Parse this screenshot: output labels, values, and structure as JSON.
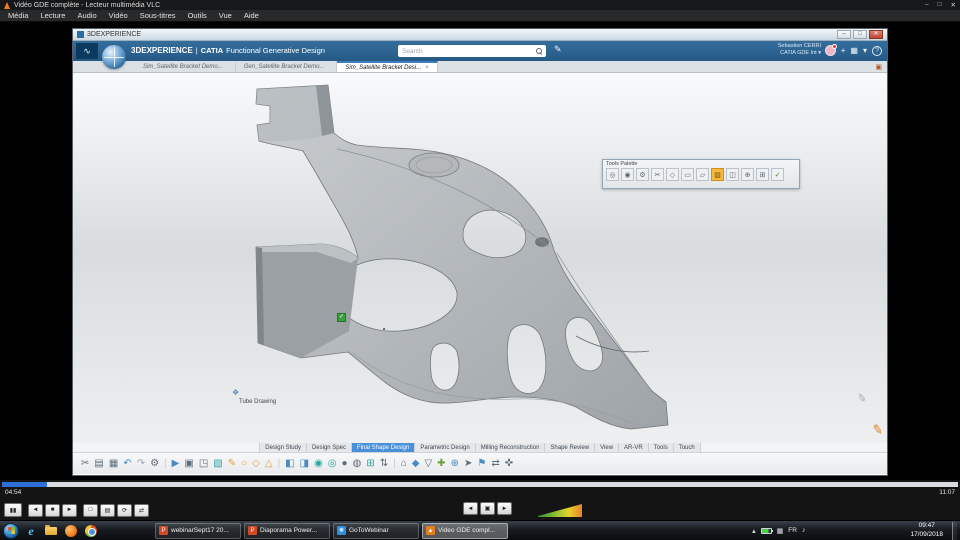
{
  "vlc": {
    "title": "Vidéo GDE complète - Lecteur multimédia VLC",
    "menu": [
      "Média",
      "Lecture",
      "Audio",
      "Vidéo",
      "Sous-titres",
      "Outils",
      "Vue",
      "Aide"
    ],
    "transport": {
      "time_current": "04:54",
      "time_total": "11:07",
      "progress_percent": 4.7,
      "primary": [
        {
          "g": "▮▮",
          "name": "pause"
        }
      ],
      "secondary": [
        {
          "g": "◄",
          "name": "previous"
        },
        {
          "g": "■",
          "name": "stop"
        },
        {
          "g": "►",
          "name": "next"
        }
      ],
      "tertiary": [
        {
          "g": "□",
          "name": "fullscreen"
        },
        {
          "g": "▤",
          "name": "playlist"
        },
        {
          "g": "⟳",
          "name": "loop"
        },
        {
          "g": "⇄",
          "name": "shuffle"
        }
      ],
      "center": [
        {
          "g": "◄",
          "name": "step-back"
        },
        {
          "g": "▣",
          "name": "bookmark"
        },
        {
          "g": "►",
          "name": "step-forward"
        }
      ]
    }
  },
  "icons": {
    "minimize": "–",
    "maximize": "□",
    "close": "✕",
    "ds_logo": "∿",
    "share": "✎",
    "plus": "+",
    "apps_grid": "▦",
    "caret_down": "▾",
    "help": "?",
    "tab_expand": "▣",
    "annotation": "❖",
    "green_check": "✓",
    "cursor_pencil": "✐",
    "tray_hidden": "▴",
    "tray_grid": "▦",
    "tray_volume": "♪",
    "ie": "e"
  },
  "app": {
    "window_title": "3DEXPERIENCE",
    "header": {
      "brand": "3DEXPERIENCE",
      "divider": "|",
      "product": "CATIA",
      "app_name": "Functional Generative Design",
      "search_placeholder": "Search",
      "user_name": "Sebastien CERRI",
      "user_role": "CATIA GDE Int ▾"
    },
    "tabs": [
      {
        "label": "Sim_Satellite Bracket Demo..."
      },
      {
        "label": "Gen_Satellite Bracket Demo..."
      },
      {
        "label": "Sim_Satellite Bracket Desi...",
        "active": true,
        "close": "×"
      }
    ],
    "tools_palette": {
      "title": "Tools Palette",
      "icons": [
        {
          "g": "◎",
          "name": "select-icon"
        },
        {
          "g": "◉",
          "name": "snap-icon"
        },
        {
          "g": "⚙",
          "name": "options-icon"
        },
        {
          "g": "✂",
          "name": "trim-icon"
        },
        {
          "g": "◇",
          "name": "diamond-icon"
        },
        {
          "g": "▭",
          "name": "rect-icon"
        },
        {
          "g": "▱",
          "name": "plane-icon"
        },
        {
          "g": "▨",
          "name": "hatch-icon",
          "active": true
        },
        {
          "g": "◫",
          "name": "panel-icon"
        },
        {
          "g": "⊕",
          "name": "insert-icon"
        },
        {
          "g": "⊞",
          "name": "grid-icon"
        },
        {
          "g": "✓",
          "name": "ok-icon",
          "c": "#2c8c2c"
        }
      ]
    },
    "viewport": {
      "annotation_label": "Tube Drawing"
    },
    "bottom_tabs": [
      {
        "label": "Design Study"
      },
      {
        "label": "Design Spec"
      },
      {
        "label": "Final Shape Design",
        "active": true
      },
      {
        "label": "Parametric Design"
      },
      {
        "label": "Milling Reconstruction"
      },
      {
        "label": "Shape Review"
      },
      {
        "label": "View"
      },
      {
        "label": "AR-VR"
      },
      {
        "label": "Tools"
      },
      {
        "label": "Touch"
      }
    ],
    "toolbar_icons": [
      {
        "g": "✂",
        "c": "#5d6d7b"
      },
      {
        "g": "▤",
        "c": "#5d6d7b"
      },
      {
        "g": "▦",
        "c": "#5d6d7b"
      },
      {
        "g": "↶",
        "c": "#4a8ac2"
      },
      {
        "g": "↷",
        "c": "#9aa4ad"
      },
      {
        "g": "⚙",
        "c": "#5d6d7b"
      },
      {
        "g": "|",
        "c": "#c8ccd0"
      },
      {
        "g": "▶",
        "c": "#4a8ac2"
      },
      {
        "g": "▣",
        "c": "#5d6d7b"
      },
      {
        "g": "◳",
        "c": "#5d6d7b"
      },
      {
        "g": "▧",
        "c": "#2ba5a0"
      },
      {
        "g": "✎",
        "c": "#e0a23a"
      },
      {
        "g": "○",
        "c": "#e0a23a"
      },
      {
        "g": "◇",
        "c": "#e0a23a"
      },
      {
        "g": "△",
        "c": "#e0a23a"
      },
      {
        "g": "|",
        "c": "#c8ccd0"
      },
      {
        "g": "◧",
        "c": "#4a8ac2"
      },
      {
        "g": "◨",
        "c": "#4a8ac2"
      },
      {
        "g": "◉",
        "c": "#2ba5a0"
      },
      {
        "g": "◎",
        "c": "#2ba5a0"
      },
      {
        "g": "●",
        "c": "#5d6d7b"
      },
      {
        "g": "◍",
        "c": "#5d6d7b"
      },
      {
        "g": "⊞",
        "c": "#2ba5a0"
      },
      {
        "g": "⇅",
        "c": "#5d6d7b"
      },
      {
        "g": "|",
        "c": "#c8ccd0"
      },
      {
        "g": "⌂",
        "c": "#5d6d7b"
      },
      {
        "g": "◆",
        "c": "#4a8ac2"
      },
      {
        "g": "▽",
        "c": "#5d6d7b"
      },
      {
        "g": "✚",
        "c": "#6b9e3a"
      },
      {
        "g": "⊕",
        "c": "#4a8ac2"
      },
      {
        "g": "➤",
        "c": "#5d6d7b"
      },
      {
        "g": "⚑",
        "c": "#4a8ac2"
      },
      {
        "g": "⇄",
        "c": "#5d6d7b"
      },
      {
        "g": "✜",
        "c": "#5d6d7b"
      }
    ]
  },
  "taskbar": {
    "items": [
      {
        "label": "webinarSept17 20...",
        "icon_glyph": "P",
        "icon_bg": "#d14a26"
      },
      {
        "label": "Diaporama Power...",
        "icon_glyph": "P",
        "icon_bg": "#d14a26"
      },
      {
        "label": "GoToWebinar",
        "icon_glyph": "❋",
        "icon_bg": "#2f8fdd"
      },
      {
        "label": "Video GDE compl...",
        "icon_glyph": "▲",
        "icon_bg": "#e57d1c",
        "active": true
      }
    ],
    "tray": {
      "lang": "FR",
      "time": "09:47",
      "date": "17/09/2018"
    }
  }
}
